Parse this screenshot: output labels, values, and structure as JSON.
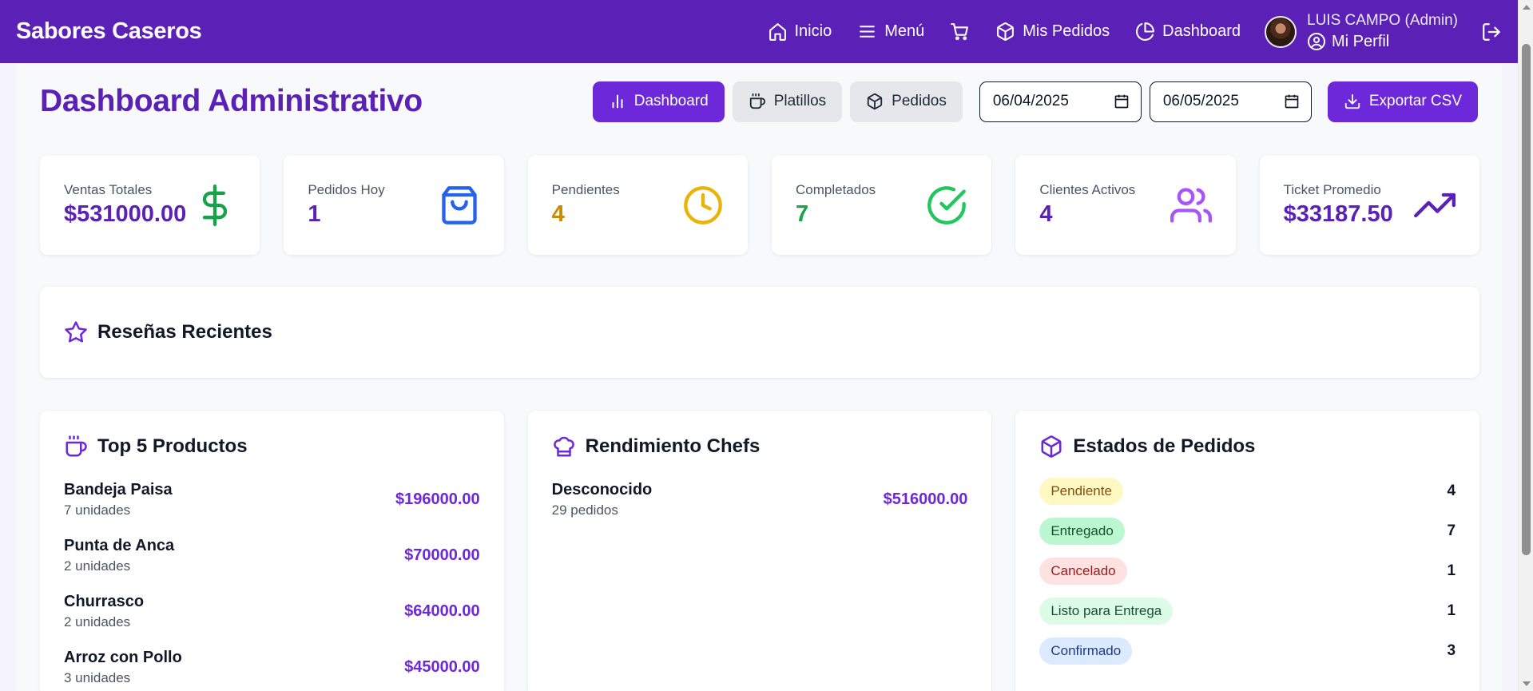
{
  "brand": "Sabores Caseros",
  "nav": {
    "inicio": "Inicio",
    "menu": "Menú",
    "mis_pedidos": "Mis Pedidos",
    "dashboard": "Dashboard"
  },
  "user": {
    "name": "LUIS CAMPO (Admin)",
    "profile": "Mi Perfil"
  },
  "page": {
    "title": "Dashboard Administrativo"
  },
  "toolbar": {
    "tab_dashboard": "Dashboard",
    "tab_platillos": "Platillos",
    "tab_pedidos": "Pedidos",
    "date_from": "06/04/2025",
    "date_to": "06/05/2025",
    "export": "Exportar CSV"
  },
  "stats": [
    {
      "label": "Ventas Totales",
      "value": "$531000.00",
      "icon": "dollar-icon",
      "color": "#16a34a",
      "value_color": "#5b21b6"
    },
    {
      "label": "Pedidos Hoy",
      "value": "1",
      "icon": "shopping-bag-icon",
      "color": "#2563eb",
      "value_color": "#5b21b6"
    },
    {
      "label": "Pendientes",
      "value": "4",
      "icon": "clock-icon",
      "color": "#eab308",
      "value_color": "#ca8a04"
    },
    {
      "label": "Completados",
      "value": "7",
      "icon": "check-circle-icon",
      "color": "#22c55e",
      "value_color": "#16a34a"
    },
    {
      "label": "Clientes Activos",
      "value": "4",
      "icon": "users-icon",
      "color": "#a855f7",
      "value_color": "#5b21b6"
    },
    {
      "label": "Ticket Promedio",
      "value": "$33187.50",
      "icon": "trending-up-icon",
      "color": "#5b21b6",
      "value_color": "#5b21b6"
    }
  ],
  "reviews": {
    "title": "Reseñas Recientes"
  },
  "top_products": {
    "title": "Top 5 Productos",
    "items": [
      {
        "name": "Bandeja Paisa",
        "sub": "7 unidades",
        "amount": "$196000.00"
      },
      {
        "name": "Punta de Anca",
        "sub": "2 unidades",
        "amount": "$70000.00"
      },
      {
        "name": "Churrasco",
        "sub": "2 unidades",
        "amount": "$64000.00"
      },
      {
        "name": "Arroz con Pollo",
        "sub": "3 unidades",
        "amount": "$45000.00"
      }
    ]
  },
  "chefs": {
    "title": "Rendimiento Chefs",
    "items": [
      {
        "name": "Desconocido",
        "sub": "29 pedidos",
        "amount": "$516000.00"
      }
    ]
  },
  "order_states": {
    "title": "Estados de Pedidos",
    "items": [
      {
        "label": "Pendiente",
        "count": "4",
        "bg": "#fef9c3",
        "fg": "#854d0e"
      },
      {
        "label": "Entregado",
        "count": "7",
        "bg": "#bbf7d0",
        "fg": "#14532d"
      },
      {
        "label": "Cancelado",
        "count": "1",
        "bg": "#fee2e2",
        "fg": "#991b1b"
      },
      {
        "label": "Listo para Entrega",
        "count": "1",
        "bg": "#dcfce7",
        "fg": "#14532d"
      },
      {
        "label": "Confirmado",
        "count": "3",
        "bg": "#dbeafe",
        "fg": "#1e3a8a"
      }
    ]
  }
}
